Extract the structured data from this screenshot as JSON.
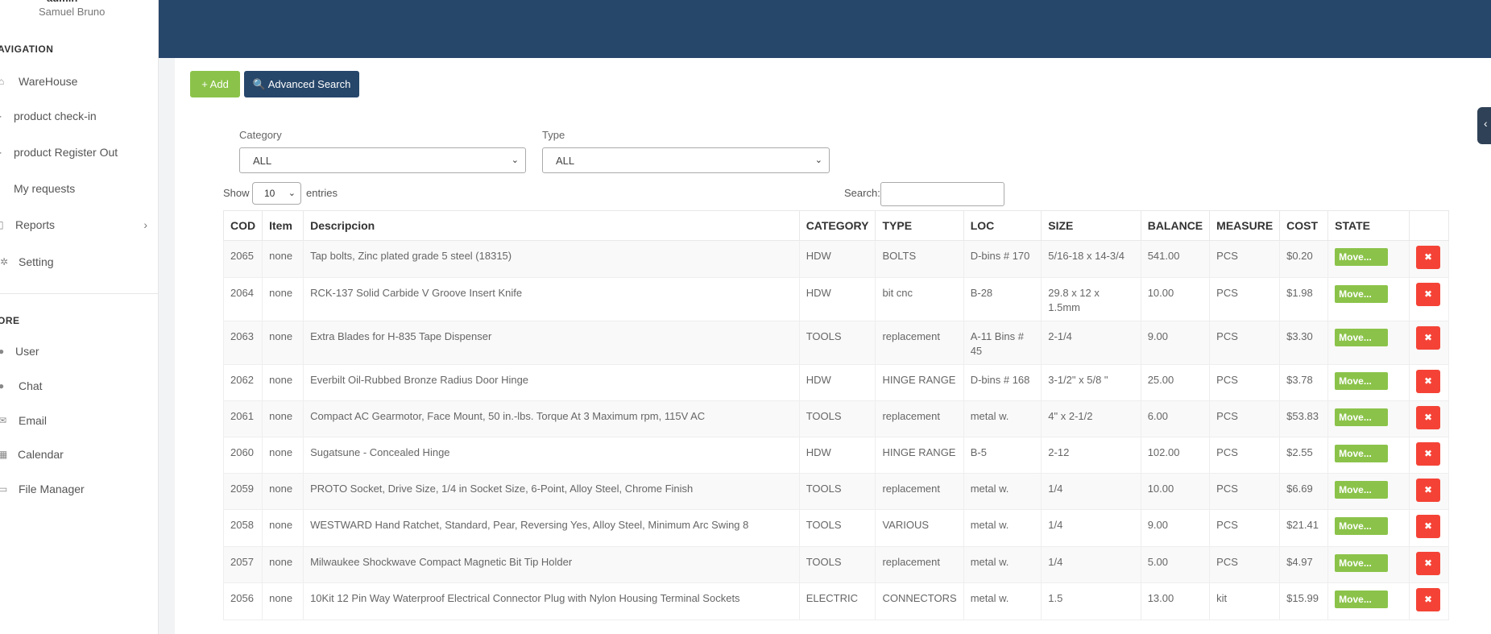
{
  "user": {
    "role": "admin",
    "name": "Samuel Bruno"
  },
  "nav": {
    "header1": "AVIGATION",
    "items1": [
      {
        "label": "WareHouse",
        "icon": "home-icon"
      },
      {
        "label": "product check-in",
        "icon": "login-icon"
      },
      {
        "label": "product Register Out",
        "icon": "logout-icon"
      },
      {
        "label": "My requests",
        "icon": "inbox-icon"
      },
      {
        "label": "Reports",
        "icon": "clipboard-icon"
      },
      {
        "label": "Setting",
        "icon": "gear-icon"
      }
    ],
    "header2": "ORE",
    "items2": [
      {
        "label": "User",
        "icon": "user-icon"
      },
      {
        "label": "Chat",
        "icon": "chat-icon"
      },
      {
        "label": "Email",
        "icon": "envelope-icon"
      },
      {
        "label": "Calendar",
        "icon": "calendar-icon"
      },
      {
        "label": "File Manager",
        "icon": "folder-icon"
      }
    ]
  },
  "toolbar": {
    "add_label": "+ Add",
    "advanced_label": "🔍 Advanced Search"
  },
  "filters": {
    "category_label": "Category",
    "category_value": "ALL",
    "type_label": "Type",
    "type_value": "ALL"
  },
  "table_controls": {
    "show": "Show",
    "entries": "entries",
    "length": "10",
    "search_label": "Search:"
  },
  "table": {
    "headers": [
      "COD",
      "Item",
      "Descripcion",
      "CATEGORY",
      "TYPE",
      "LOC",
      "SIZE",
      "BALANCE",
      "MEASURE",
      "COST",
      "STATE",
      ""
    ],
    "state_label": "Move...",
    "delete_label": "✖",
    "rows": [
      [
        "2065",
        "none",
        "Tap bolts, Zinc plated grade 5 steel (18315)",
        "HDW",
        "BOLTS",
        "D-bins # 170",
        "5/16-18 x 14-3/4",
        "541.00",
        "PCS",
        "$0.20"
      ],
      [
        "2064",
        "none",
        "RCK-137 Solid Carbide V Groove Insert Knife",
        "HDW",
        "bit cnc",
        "B-28",
        "29.8 x 12 x 1.5mm",
        "10.00",
        "PCS",
        "$1.98"
      ],
      [
        "2063",
        "none",
        "Extra Blades for H-835 Tape Dispenser",
        "TOOLS",
        "replacement",
        "A-11 Bins # 45",
        "2-1/4",
        "9.00",
        "PCS",
        "$3.30"
      ],
      [
        "2062",
        "none",
        "Everbilt Oil-Rubbed Bronze Radius Door Hinge",
        "HDW",
        "HINGE RANGE",
        "D-bins # 168",
        "3-1/2\" x 5/8 \"",
        "25.00",
        "PCS",
        "$3.78"
      ],
      [
        "2061",
        "none",
        "Compact AC Gearmotor, Face Mount, 50 in.-lbs. Torque At 3 Maximum rpm, 115V AC",
        "TOOLS",
        "replacement",
        "metal w.",
        "4\" x 2-1/2",
        "6.00",
        "PCS",
        "$53.83"
      ],
      [
        "2060",
        "none",
        "Sugatsune - Concealed Hinge",
        "HDW",
        "HINGE RANGE",
        "B-5",
        "2-12",
        "102.00",
        "PCS",
        "$2.55"
      ],
      [
        "2059",
        "none",
        "PROTO Socket, Drive Size, 1/4 in Socket Size, 6-Point, Alloy Steel, Chrome Finish",
        "TOOLS",
        "replacement",
        "metal w.",
        "1/4",
        "10.00",
        "PCS",
        "$6.69"
      ],
      [
        "2058",
        "none",
        "WESTWARD Hand Ratchet, Standard, Pear, Reversing Yes, Alloy Steel, Minimum Arc Swing 8",
        "TOOLS",
        "VARIOUS",
        "metal w.",
        "1/4",
        "9.00",
        "PCS",
        "$21.41"
      ],
      [
        "2057",
        "none",
        "Milwaukee Shockwave Compact Magnetic Bit Tip Holder",
        "TOOLS",
        "replacement",
        "metal w.",
        "1/4",
        "5.00",
        "PCS",
        "$4.97"
      ],
      [
        "2056",
        "none",
        "10Kit 12 Pin Way Waterproof Electrical Connector Plug with Nylon Housing Terminal Sockets",
        "ELECTRIC",
        "CONNECTORS",
        "metal w.",
        "1.5",
        "13.00",
        "kit",
        "$15.99"
      ]
    ]
  }
}
